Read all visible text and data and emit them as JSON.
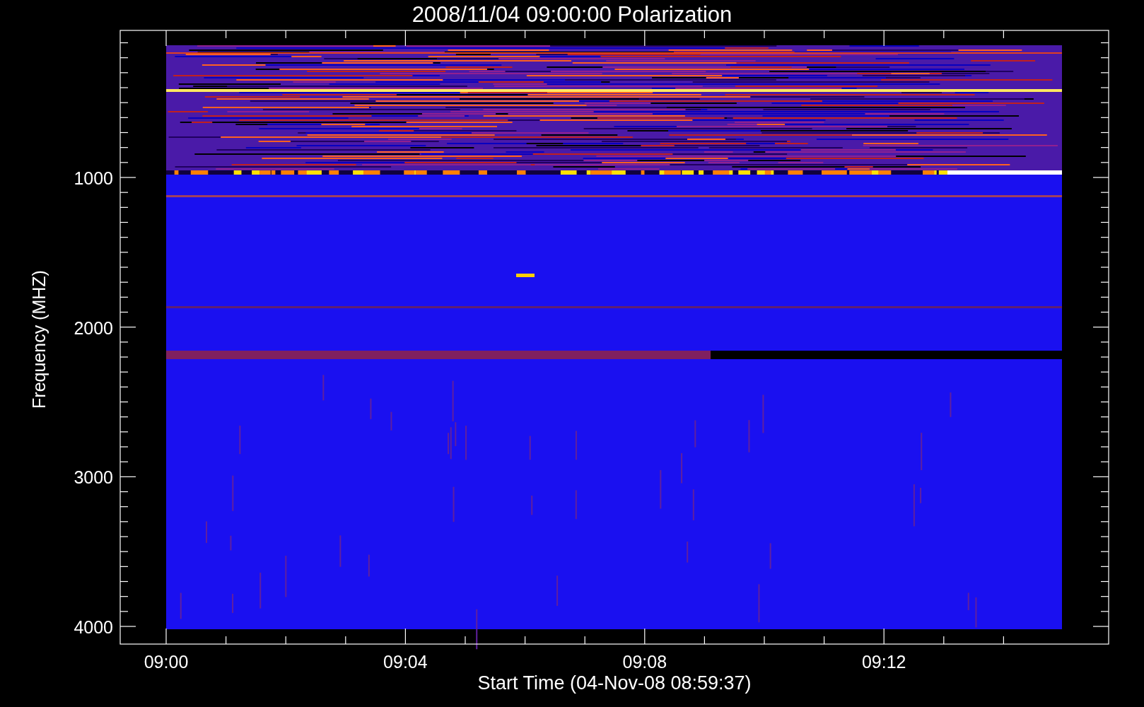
{
  "plot": {
    "title": "2008/11/04 09:00:00 Polarization",
    "ylabel": "Frequency (MHZ)",
    "xlabel": "Start Time (04-Nov-08 08:59:37)",
    "yticks": [
      "1000",
      "2000",
      "3000",
      "4000"
    ],
    "xticks": [
      "09:00",
      "09:04",
      "09:08",
      "09:12"
    ]
  }
}
